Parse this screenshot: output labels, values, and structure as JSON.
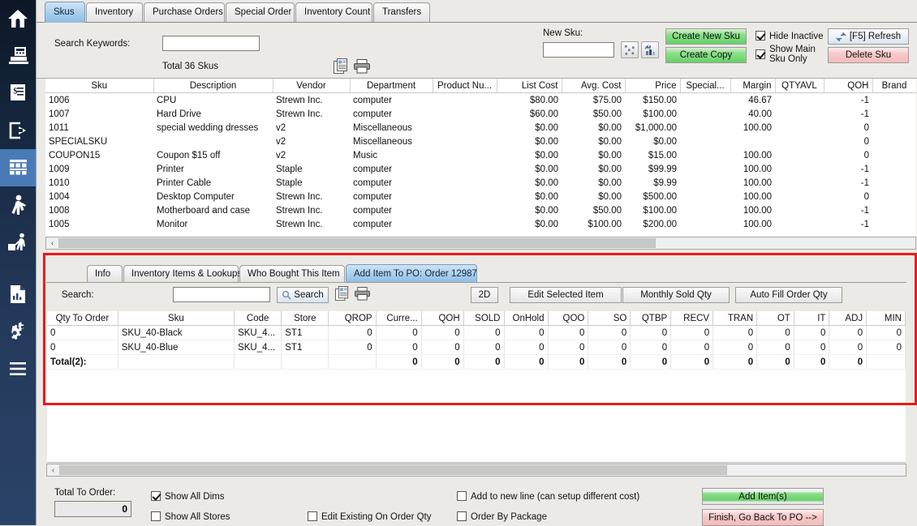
{
  "sidebar": {
    "items": [
      {
        "name": "home",
        "selected": false
      },
      {
        "name": "register",
        "selected": false
      },
      {
        "name": "invoice",
        "selected": false
      },
      {
        "name": "logout",
        "selected": false
      },
      {
        "name": "inventory-shelf",
        "selected": true
      },
      {
        "name": "customer",
        "selected": false
      },
      {
        "name": "employee",
        "selected": false
      },
      {
        "name": "reports",
        "selected": false
      },
      {
        "name": "settings",
        "selected": false
      },
      {
        "name": "menu",
        "selected": false
      }
    ]
  },
  "top_tabs": [
    {
      "label": "Skus",
      "active": true
    },
    {
      "label": "Inventory",
      "active": false
    },
    {
      "label": "Purchase Orders",
      "active": false
    },
    {
      "label": "Special Order",
      "active": false
    },
    {
      "label": "Inventory Count",
      "active": false
    },
    {
      "label": "Transfers",
      "active": false
    }
  ],
  "search_area": {
    "keywords_label": "Search Keywords:",
    "keywords_value": "",
    "total_text": "Total 36 Skus",
    "new_sku_label": "New Sku:",
    "new_sku_value": "",
    "create_new_sku": "Create New Sku",
    "create_copy": "Create Copy",
    "hide_inactive": "Hide Inactive",
    "show_main_sku_only_line1": "Show Main",
    "show_main_sku_only_line2": "Sku Only",
    "hide_inactive_checked": true,
    "show_main_checked": true,
    "refresh": "[F5] Refresh",
    "delete_sku": "Delete Sku"
  },
  "sku_grid": {
    "columns": [
      "Sku",
      "Description",
      "Vendor",
      "Department",
      "Product Nu...",
      "List Cost",
      "Avg. Cost",
      "Price",
      "Special...",
      "Margin",
      "QTYAVL",
      "QOH",
      "Brand"
    ],
    "rows": [
      {
        "sku": "1006",
        "description": "CPU",
        "vendor": "Strewn Inc.",
        "department": "computer",
        "product_nu": "",
        "list_cost": "$80.00",
        "avg_cost": "$75.00",
        "price": "$150.00",
        "special": "",
        "margin": "46.67",
        "qtyavl": "",
        "qoh": "-1",
        "brand": ""
      },
      {
        "sku": "1007",
        "description": "Hard Drive",
        "vendor": "Strewn Inc.",
        "department": "computer",
        "product_nu": "",
        "list_cost": "$60.00",
        "avg_cost": "$50.00",
        "price": "$100.00",
        "special": "",
        "margin": "40.00",
        "qtyavl": "",
        "qoh": "-1",
        "brand": ""
      },
      {
        "sku": "1011",
        "description": "special wedding dresses",
        "vendor": "v2",
        "department": "Miscellaneous",
        "product_nu": "",
        "list_cost": "$0.00",
        "avg_cost": "$0.00",
        "price": "$1,000.00",
        "special": "",
        "margin": "100.00",
        "qtyavl": "",
        "qoh": "0",
        "brand": ""
      },
      {
        "sku": "SPECIALSKU",
        "description": "",
        "vendor": "v2",
        "department": "Miscellaneous",
        "product_nu": "",
        "list_cost": "$0.00",
        "avg_cost": "$0.00",
        "price": "$0.00",
        "special": "",
        "margin": "",
        "qtyavl": "",
        "qoh": "0",
        "brand": ""
      },
      {
        "sku": "COUPON15",
        "description": "Coupon $15 off",
        "vendor": "v2",
        "department": "Music",
        "product_nu": "",
        "list_cost": "$0.00",
        "avg_cost": "$0.00",
        "price": "$15.00",
        "special": "",
        "margin": "100.00",
        "qtyavl": "",
        "qoh": "0",
        "brand": ""
      },
      {
        "sku": "1009",
        "description": "Printer",
        "vendor": "Staple",
        "department": "computer",
        "product_nu": "",
        "list_cost": "$0.00",
        "avg_cost": "$0.00",
        "price": "$99.99",
        "special": "",
        "margin": "100.00",
        "qtyavl": "",
        "qoh": "-1",
        "brand": ""
      },
      {
        "sku": "1010",
        "description": "Printer Cable",
        "vendor": "Staple",
        "department": "computer",
        "product_nu": "",
        "list_cost": "$0.00",
        "avg_cost": "$0.00",
        "price": "$9.99",
        "special": "",
        "margin": "100.00",
        "qtyavl": "",
        "qoh": "-1",
        "brand": ""
      },
      {
        "sku": "1004",
        "description": "Desktop Computer",
        "vendor": "Strewn Inc.",
        "department": "computer",
        "product_nu": "",
        "list_cost": "$0.00",
        "avg_cost": "$0.00",
        "price": "$500.00",
        "special": "",
        "margin": "100.00",
        "qtyavl": "",
        "qoh": "0",
        "brand": ""
      },
      {
        "sku": "1008",
        "description": "Motherboard and case",
        "vendor": "Strewn Inc.",
        "department": "computer",
        "product_nu": "",
        "list_cost": "$0.00",
        "avg_cost": "$50.00",
        "price": "$100.00",
        "special": "",
        "margin": "100.00",
        "qtyavl": "",
        "qoh": "-1",
        "brand": ""
      },
      {
        "sku": "1005",
        "description": "Monitor",
        "vendor": "Strewn Inc.",
        "department": "computer",
        "product_nu": "",
        "list_cost": "$0.00",
        "avg_cost": "$100.00",
        "price": "$200.00",
        "special": "",
        "margin": "100.00",
        "qtyavl": "",
        "qoh": "-1",
        "brand": ""
      }
    ]
  },
  "sub_tabs": [
    {
      "label": "Info",
      "active": false
    },
    {
      "label": "Inventory Items & Lookups",
      "active": false
    },
    {
      "label": "Who Bought This Item",
      "active": false
    },
    {
      "label": "Add Item To PO: Order 12987",
      "active": true
    }
  ],
  "po_toolbar": {
    "search_label": "Search:",
    "search_value": "",
    "search_button": "Search",
    "two_d": "2D",
    "edit_selected_item": "Edit Selected Item",
    "monthly_sold_qty": "Monthly Sold Qty",
    "auto_fill_order_qty": "Auto Fill Order Qty"
  },
  "po_grid": {
    "columns": [
      "Qty To Order",
      "Sku",
      "Code",
      "Store",
      "QROP",
      "Curre...",
      "QOH",
      "SOLD",
      "OnHold",
      "QOO",
      "SO",
      "QTBP",
      "RECV",
      "TRAN",
      "OT",
      "IT",
      "ADJ",
      "MIN"
    ],
    "rows": [
      {
        "qty_to_order": "0",
        "sku": "SKU_40-Black",
        "code": "SKU_4...",
        "store": "ST1",
        "qrop": "0",
        "curre": "0",
        "qoh": "0",
        "sold": "0",
        "onhold": "0",
        "qoo": "0",
        "so": "0",
        "qtbp": "0",
        "recv": "0",
        "tran": "0",
        "ot": "0",
        "it": "0",
        "adj": "0",
        "min": "0"
      },
      {
        "qty_to_order": "0",
        "sku": "SKU_40-Blue",
        "code": "SKU_4...",
        "store": "ST1",
        "qrop": "0",
        "curre": "0",
        "qoh": "0",
        "sold": "0",
        "onhold": "0",
        "qoo": "0",
        "so": "0",
        "qtbp": "0",
        "recv": "0",
        "tran": "0",
        "ot": "0",
        "it": "0",
        "adj": "0",
        "min": "0"
      }
    ],
    "total_row": {
      "label": "Total(2):",
      "qrop": "",
      "curre": "0",
      "qoh": "0",
      "sold": "0",
      "onhold": "0",
      "qoo": "0",
      "so": "0",
      "qtbp": "0",
      "recv": "0",
      "tran": "0",
      "ot": "0",
      "it": "0",
      "adj": "0",
      "min": ""
    }
  },
  "footer": {
    "total_to_order_label": "Total To Order:",
    "total_to_order_value": "0",
    "show_all_dims": "Show All Dims",
    "show_all_dims_checked": true,
    "show_all_stores": "Show All Stores",
    "show_all_stores_checked": false,
    "edit_existing_on_order_qty": "Edit Existing On Order Qty",
    "edit_existing_checked": false,
    "add_to_new_line": "Add to new line (can setup different cost)",
    "add_to_new_line_checked": false,
    "order_by_package": "Order By Package",
    "order_by_package_checked": false,
    "add_items": "Add Item(s)",
    "finish_go_back": "Finish, Go Back To PO -->"
  },
  "colors": {
    "accent_blue": "#4a7ab5",
    "highlight_red": "#e81b1b",
    "grid_red_text": "#e8403a",
    "green_button": "#6ad069"
  }
}
